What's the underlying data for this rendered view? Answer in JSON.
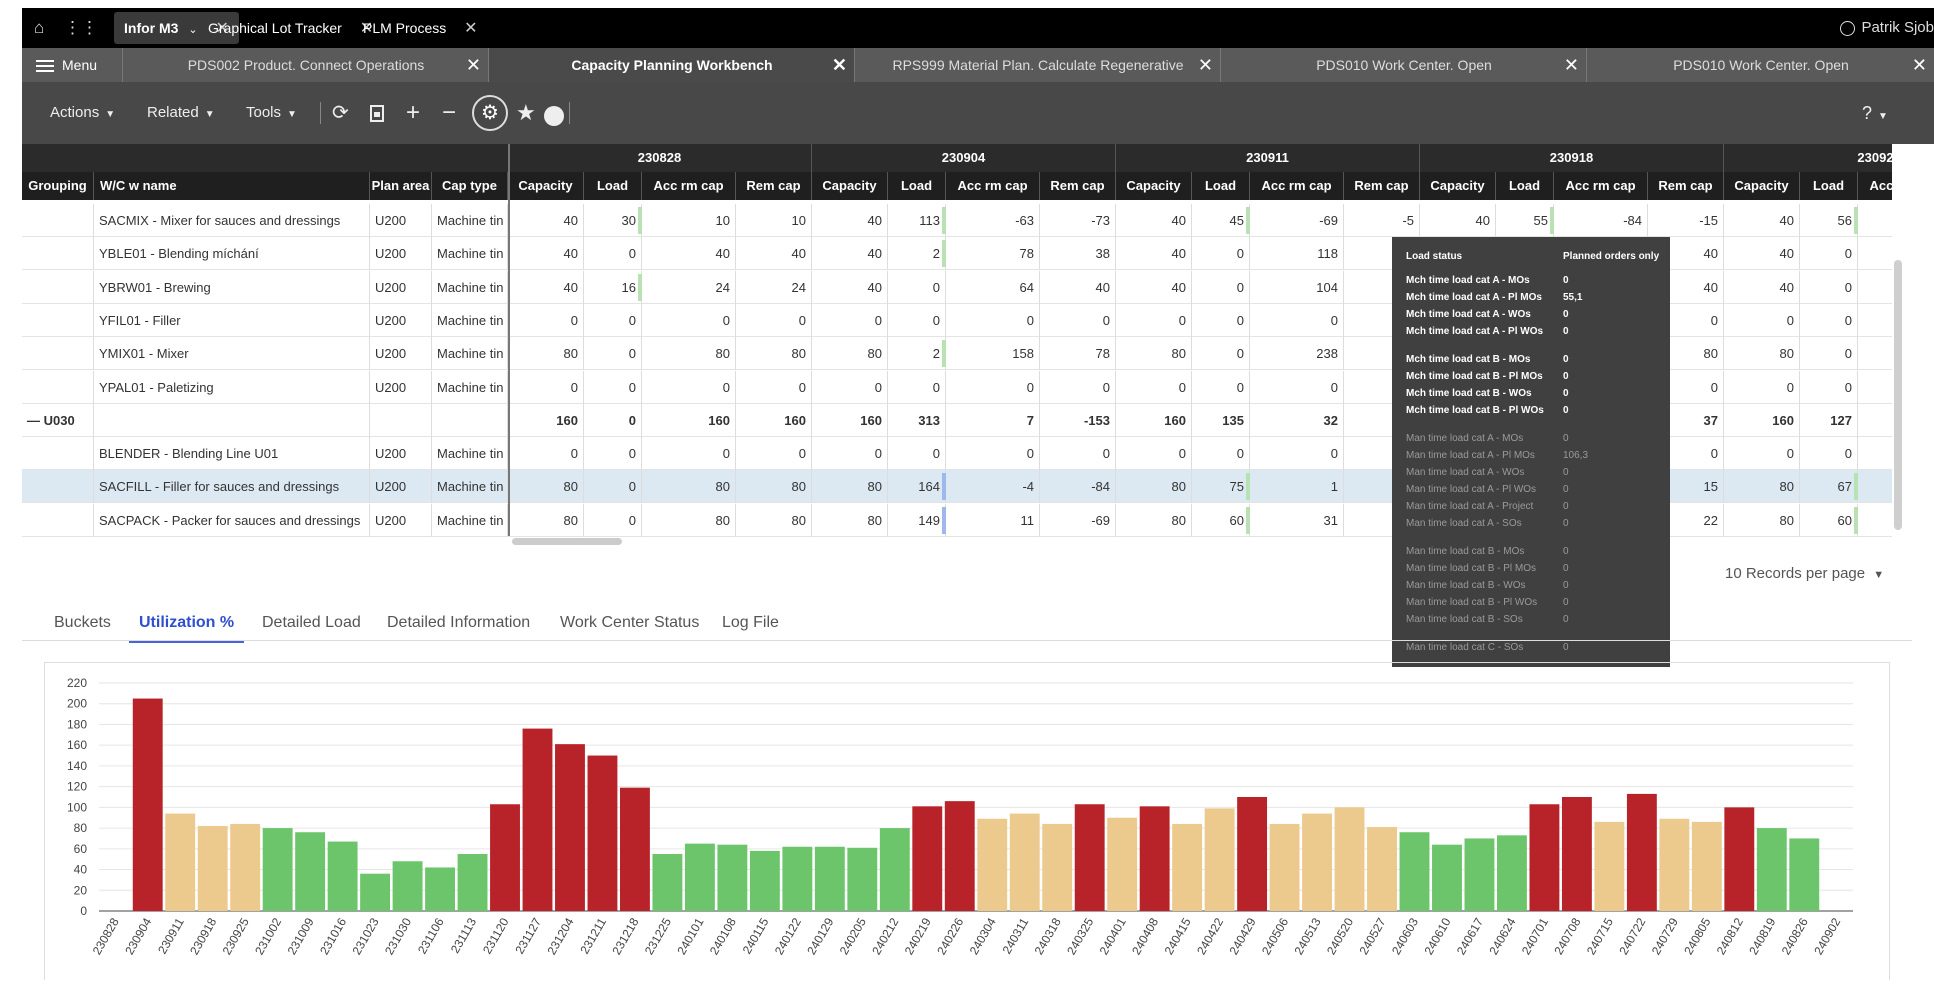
{
  "topbar": {
    "tabs": [
      {
        "label": "Infor M3"
      },
      {
        "label": "Graphical Lot Tracker"
      },
      {
        "label": "PLM Process"
      }
    ],
    "user": "Patrik Sjob"
  },
  "tabbar": {
    "menu_label": "Menu",
    "tabs": [
      {
        "label": "PDS002 Product. Connect Operations"
      },
      {
        "label": "Capacity Planning Workbench"
      },
      {
        "label": "RPS999 Material Plan. Calculate Regenerative"
      },
      {
        "label": "PDS010 Work Center. Open"
      },
      {
        "label": "PDS010 Work Center. Open"
      }
    ]
  },
  "toolbar": {
    "actions": "Actions",
    "related": "Related",
    "tools": "Tools",
    "help": "?"
  },
  "grid": {
    "fixed_headers": [
      "Grouping",
      "W/C w name",
      "Plan area",
      "Cap type"
    ],
    "week_labels": [
      "230828",
      "230904",
      "230911",
      "230918",
      "23092"
    ],
    "sub_headers": [
      "Capacity",
      "Load",
      "Acc rm cap",
      "Rem cap"
    ],
    "rows": [
      {
        "grouping": "",
        "wc": "SACMIX - Mixer for sauces and dressings",
        "area": "U200",
        "cap": "Machine tin",
        "v": [
          "40",
          "30",
          "10",
          "10",
          "40",
          "113",
          "-63",
          "-73",
          "40",
          "45",
          "-69",
          "-5",
          "40",
          "55",
          "-84",
          "-15",
          "40",
          "56"
        ]
      },
      {
        "grouping": "",
        "wc": "YBLE01 - Blending míchání",
        "area": "U200",
        "cap": "Machine tin",
        "v": [
          "40",
          "0",
          "40",
          "40",
          "40",
          "2",
          "78",
          "38",
          "40",
          "0",
          "118",
          "",
          "",
          "",
          "",
          "40",
          "40",
          "0"
        ]
      },
      {
        "grouping": "",
        "wc": "YBRW01 - Brewing",
        "area": "U200",
        "cap": "Machine tin",
        "v": [
          "40",
          "16",
          "24",
          "24",
          "40",
          "0",
          "64",
          "40",
          "40",
          "0",
          "104",
          "",
          "",
          "",
          "",
          "40",
          "40",
          "0"
        ]
      },
      {
        "grouping": "",
        "wc": "YFIL01 - Filler",
        "area": "U200",
        "cap": "Machine tin",
        "v": [
          "0",
          "0",
          "0",
          "0",
          "0",
          "0",
          "0",
          "0",
          "0",
          "0",
          "0",
          "",
          "",
          "",
          "",
          "0",
          "0",
          "0"
        ]
      },
      {
        "grouping": "",
        "wc": "YMIX01 - Mixer",
        "area": "U200",
        "cap": "Machine tin",
        "v": [
          "80",
          "0",
          "80",
          "80",
          "80",
          "2",
          "158",
          "78",
          "80",
          "0",
          "238",
          "",
          "",
          "",
          "",
          "80",
          "80",
          "0"
        ]
      },
      {
        "grouping": "",
        "wc": "YPAL01 - Paletizing",
        "area": "U200",
        "cap": "Machine tin",
        "v": [
          "0",
          "0",
          "0",
          "0",
          "0",
          "0",
          "0",
          "0",
          "0",
          "0",
          "0",
          "",
          "",
          "",
          "",
          "0",
          "0",
          "0"
        ]
      },
      {
        "grouping": "— U030",
        "wc": "",
        "area": "",
        "cap": "",
        "v": [
          "160",
          "0",
          "160",
          "160",
          "160",
          "313",
          "7",
          "-153",
          "160",
          "135",
          "32",
          "",
          "",
          "",
          "",
          "37",
          "160",
          "127"
        ]
      },
      {
        "grouping": "",
        "wc": "BLENDER - Blending Line U01",
        "area": "U200",
        "cap": "Machine tin",
        "v": [
          "0",
          "0",
          "0",
          "0",
          "0",
          "0",
          "0",
          "0",
          "0",
          "0",
          "0",
          "",
          "",
          "",
          "",
          "0",
          "0",
          "0"
        ]
      },
      {
        "grouping": "",
        "wc": "SACFILL - Filler for sauces and dressings",
        "area": "U200",
        "cap": "Machine tin",
        "v": [
          "80",
          "0",
          "80",
          "80",
          "80",
          "164",
          "-4",
          "-84",
          "80",
          "75",
          "1",
          "",
          "",
          "",
          "",
          "15",
          "80",
          "67"
        ]
      },
      {
        "grouping": "",
        "wc": "SACPACK - Packer for sauces and dressings",
        "area": "U200",
        "cap": "Machine tin",
        "v": [
          "80",
          "0",
          "80",
          "80",
          "80",
          "149",
          "11",
          "-69",
          "80",
          "60",
          "31",
          "",
          "",
          "",
          "",
          "22",
          "80",
          "60"
        ]
      }
    ],
    "records_per_page": "10 Records per page"
  },
  "tooltip": {
    "col1": "Load status",
    "col2": "Planned orders only",
    "groups": [
      {
        "dim": false,
        "items": [
          [
            "Mch time load cat A - MOs",
            "0"
          ],
          [
            "Mch time load cat A - Pl MOs",
            "55,1"
          ],
          [
            "Mch time load cat A - WOs",
            "0"
          ],
          [
            "Mch time load cat A - Pl WOs",
            "0"
          ]
        ]
      },
      {
        "dim": false,
        "items": [
          [
            "Mch time load cat B - MOs",
            "0"
          ],
          [
            "Mch time load cat B - Pl MOs",
            "0"
          ],
          [
            "Mch time load cat B - WOs",
            "0"
          ],
          [
            "Mch time load cat B - Pl WOs",
            "0"
          ]
        ]
      },
      {
        "dim": true,
        "items": [
          [
            "Man time load cat A - MOs",
            "0"
          ],
          [
            "Man time load cat A - Pl MOs",
            "106,3"
          ],
          [
            "Man time load cat A - WOs",
            "0"
          ],
          [
            "Man time load cat A - Pl WOs",
            "0"
          ],
          [
            "Man time load cat A - Project",
            "0"
          ],
          [
            "Man time load cat A - SOs",
            "0"
          ]
        ]
      },
      {
        "dim": true,
        "items": [
          [
            "Man time load cat B - MOs",
            "0"
          ],
          [
            "Man time load cat B - Pl MOs",
            "0"
          ],
          [
            "Man time load cat B - WOs",
            "0"
          ],
          [
            "Man time load cat B - Pl WOs",
            "0"
          ],
          [
            "Man time load cat B - SOs",
            "0"
          ]
        ]
      },
      {
        "dim": true,
        "items": [
          [
            "Man time load cat C - SOs",
            "0"
          ]
        ]
      }
    ]
  },
  "bottom_tabs": [
    "Buckets",
    "Utilization %",
    "Detailed Load",
    "Detailed Information",
    "Work Center Status",
    "Log File"
  ],
  "colors": {
    "over": "#b8232a",
    "mid": "#ecc98d",
    "ok": "#6cc46b",
    "accent": "#4a62d9"
  },
  "chart_data": {
    "type": "bar",
    "title": "",
    "xlabel": "",
    "ylabel": "",
    "ylim": [
      0,
      220
    ],
    "yticks": [
      0,
      20,
      40,
      60,
      80,
      100,
      120,
      140,
      160,
      180,
      200,
      220
    ],
    "categories": [
      "230828",
      "230904",
      "230911",
      "230918",
      "230925",
      "231002",
      "231009",
      "231016",
      "231023",
      "231030",
      "231106",
      "231113",
      "231120",
      "231127",
      "231204",
      "231211",
      "231218",
      "231225",
      "240101",
      "240108",
      "240115",
      "240122",
      "240129",
      "240205",
      "240212",
      "240219",
      "240226",
      "240304",
      "240311",
      "240318",
      "240325",
      "240401",
      "240408",
      "240415",
      "240422",
      "240429",
      "240506",
      "240513",
      "240520",
      "240527",
      "240603",
      "240610",
      "240617",
      "240624",
      "240701",
      "240708",
      "240715",
      "240722",
      "240729",
      "240805",
      "240812",
      "240819",
      "240826",
      "240902"
    ],
    "values": [
      0,
      205,
      94,
      82,
      84,
      80,
      76,
      67,
      36,
      48,
      42,
      55,
      103,
      176,
      161,
      150,
      119,
      55,
      65,
      64,
      58,
      62,
      62,
      61,
      80,
      101,
      106,
      89,
      94,
      84,
      103,
      90,
      101,
      84,
      99,
      110,
      84,
      94,
      100,
      81,
      76,
      64,
      70,
      73,
      103,
      110,
      86,
      113,
      89,
      86,
      100,
      80,
      70,
      0
    ],
    "category_status": [
      "ok",
      "over",
      "mid",
      "mid",
      "mid",
      "ok",
      "ok",
      "ok",
      "ok",
      "ok",
      "ok",
      "ok",
      "over",
      "over",
      "over",
      "over",
      "over",
      "ok",
      "ok",
      "ok",
      "ok",
      "ok",
      "ok",
      "ok",
      "ok",
      "over",
      "over",
      "mid",
      "mid",
      "mid",
      "over",
      "mid",
      "over",
      "mid",
      "mid",
      "over",
      "mid",
      "mid",
      "mid",
      "mid",
      "ok",
      "ok",
      "ok",
      "ok",
      "over",
      "over",
      "mid",
      "over",
      "mid",
      "mid",
      "over",
      "ok",
      "ok",
      "ok"
    ]
  }
}
